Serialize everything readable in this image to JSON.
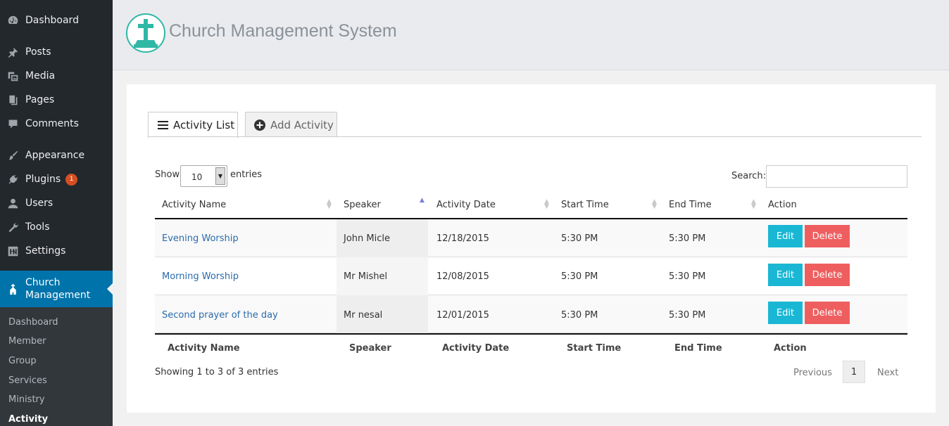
{
  "sidebar": {
    "menu": [
      {
        "label": "Dashboard",
        "icon": "dashboard-icon"
      },
      {
        "label": "Posts",
        "icon": "pushpin-icon"
      },
      {
        "label": "Media",
        "icon": "media-icon"
      },
      {
        "label": "Pages",
        "icon": "pages-icon"
      },
      {
        "label": "Comments",
        "icon": "comment-icon"
      },
      {
        "label": "Appearance",
        "icon": "paintbrush-icon"
      },
      {
        "label": "Plugins",
        "icon": "plug-icon",
        "badge": "1"
      },
      {
        "label": "Users",
        "icon": "user-icon"
      },
      {
        "label": "Tools",
        "icon": "wrench-icon"
      },
      {
        "label": "Settings",
        "icon": "settings-icon"
      }
    ],
    "active": {
      "label_line1": "Church",
      "label_line2": "Management",
      "icon": "church-icon"
    },
    "submenu": [
      "Dashboard",
      "Member",
      "Group",
      "Services",
      "Ministry",
      "Activity"
    ]
  },
  "header": {
    "title": "Church Management System"
  },
  "tabs": {
    "list_label": "Activity List",
    "add_label": "Add Activity"
  },
  "controls": {
    "show_label": "Show",
    "entries_value": "10",
    "entries_label": "entries",
    "search_label": "Search:"
  },
  "table": {
    "columns": [
      "Activity Name",
      "Speaker",
      "Activity Date",
      "Start Time",
      "End Time",
      "Action"
    ],
    "rows": [
      {
        "name": "Evening Worship",
        "speaker": "John Micle",
        "date": "12/18/2015",
        "start": "5:30 PM",
        "end": "5:30 PM"
      },
      {
        "name": "Morning Worship",
        "speaker": "Mr Mishel",
        "date": "12/08/2015",
        "start": "5:30 PM",
        "end": "5:30 PM"
      },
      {
        "name": "Second prayer of the day",
        "speaker": "Mr nesal",
        "date": "12/01/2015",
        "start": "5:30 PM",
        "end": "5:30 PM"
      }
    ],
    "edit_label": "Edit",
    "delete_label": "Delete"
  },
  "footer": {
    "info": "Showing 1 to 3 of 3 entries",
    "previous": "Previous",
    "page": "1",
    "next": "Next"
  },
  "colors": {
    "sidebar": "#23282d",
    "active": "#0073aa",
    "edit": "#1ab7d4",
    "delete": "#ef5e5f",
    "link": "#2a6bab",
    "logo": "#2fb8a6"
  }
}
